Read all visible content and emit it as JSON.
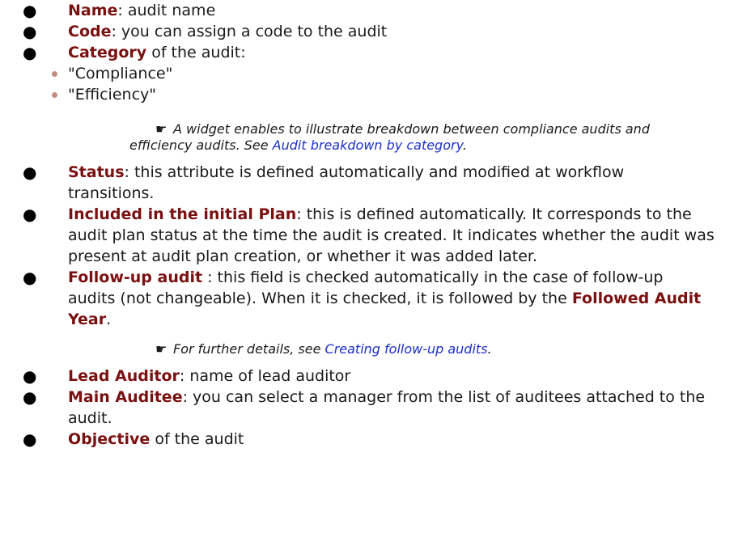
{
  "items": {
    "name": {
      "term": "Name",
      "rest": ": audit name"
    },
    "code": {
      "term": "Code",
      "rest": ": you can assign a code to the audit"
    },
    "category": {
      "term": "Category",
      "rest": " of the audit:",
      "options": [
        "\"Compliance\"",
        "\"Efficiency\""
      ],
      "note": {
        "hand_icon": "pointing-hand-icon",
        "text": "A widget enables to illustrate breakdown between compliance audits and efficiency audits. See ",
        "link": "Audit breakdown by category",
        "after": "."
      }
    },
    "status": {
      "term": "Status",
      "rest": ": this attribute is defined automatically and modified at workflow transitions."
    },
    "included": {
      "term": "Included  in the initial Plan",
      "rest": ": this is defined automatically. It corresponds to the audit plan status at the time the audit is created. It indicates whether the audit was present at audit plan creation, or whether it was added later."
    },
    "followup": {
      "term": "Follow-up audit",
      "rest": " : this field is checked automatically in the case of follow-up audits (not changeable). When it is checked, it is followed by the ",
      "term2": "Followed Audit Year",
      "after": ".",
      "note": {
        "text": "For further details, see ",
        "link": "Creating follow-up audits",
        "after": "."
      }
    },
    "lead": {
      "term": "Lead Auditor",
      "rest": ": name of lead auditor"
    },
    "auditee": {
      "term": "Main Auditee",
      "rest": ": you can select a manager from the list of auditees attached to the audit."
    },
    "objective": {
      "term": "Objective",
      "rest": " of the audit"
    }
  },
  "colors": {
    "term": "#7b1010",
    "link": "#1a30c8",
    "sub_bullet": "#c98a82"
  }
}
